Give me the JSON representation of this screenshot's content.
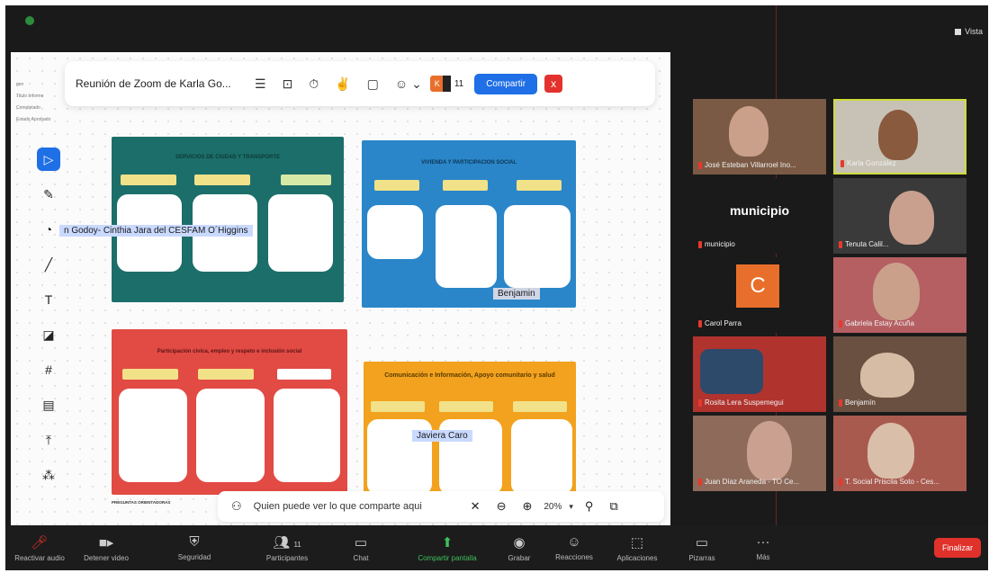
{
  "meeting": {
    "title": "Reunión de Zoom de Karla Go...",
    "participant_count": "11",
    "share_label": "Compartir",
    "close_label": "x",
    "view_label": "Vista",
    "avatar_letter": "K"
  },
  "share_bar": {
    "question": "Quien puede ver lo que comparte aqui",
    "zoom": "20%"
  },
  "board": {
    "sideinfo": [
      "gen",
      "Titulo Informe",
      "Completado",
      "Estado Aprobado"
    ],
    "cards": [
      {
        "title": "SERVICIOS DE CIUDAD Y TRANSPORTE"
      },
      {
        "title": "VIVIENDA Y PARTICIPACION SOCIAL"
      },
      {
        "title": "Participación cívica, empleo y respeto e inclusión social"
      },
      {
        "title": "Comunicación e Información, Apoyo comunitario y salud"
      }
    ],
    "cursor_labels": {
      "godoy": "n Godoy- Cinthia Jara del CESFAM O´Higgins",
      "benjamin": "Benjamin",
      "javiera": "Javiera Caro"
    },
    "questions_label": "PREGUNTAS ORIENTADORAS"
  },
  "participants": [
    {
      "name": "José Esteban Villarroel Ino..."
    },
    {
      "name": "Karla González"
    },
    {
      "name": "municipio"
    },
    {
      "name": "Tenuta Calil..."
    },
    {
      "name": "Carol Parra",
      "initial": "C"
    },
    {
      "name": "Gabriela Estay Acuña"
    },
    {
      "name": "Rosita Lera Suspemegui"
    },
    {
      "name": "Benjamín"
    },
    {
      "name": "Juan Díaz Araneda - TO Ce..."
    },
    {
      "name": "T. Social Priscila Soto - Ces..."
    }
  ],
  "municipio_heading": "municipio",
  "toolbar": {
    "audio": "Reactivar audio",
    "video": "Detener video",
    "security": "Seguridad",
    "participants": "Participantes",
    "participants_count": "11",
    "chat": "Chat",
    "share_screen": "Compartir pantalla",
    "record": "Grabar",
    "reactions": "Reacciones",
    "apps": "Aplicaciones",
    "whiteboards": "Pizarras",
    "more": "Más",
    "end": "Finalizar"
  },
  "colors": {
    "card_teal": "#1c6e6a",
    "card_blue": "#2a86c8",
    "card_red": "#e24a44",
    "card_orange": "#f2a21e",
    "accent_blue": "#1f6fe6",
    "end_red": "#e0312b",
    "share_green": "#3ec05a"
  }
}
